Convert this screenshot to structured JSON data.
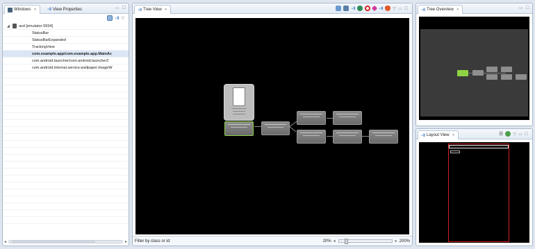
{
  "left": {
    "tabs": [
      {
        "label": "Windows"
      },
      {
        "label": "View Properties"
      }
    ],
    "tree": {
      "device": "avd [emulator-5554]",
      "items": [
        "StatusBar",
        "StatusBarExpanded",
        "TrackingView",
        "com.example.app/com.example.app.MainAc",
        "com.android.launcher/com.android.launcher2",
        "com.android.internal.service.wallpaper.ImageW"
      ],
      "selected_index": 3
    }
  },
  "tree_view": {
    "tab_label": "Tree View",
    "filter_label": "Filter by class or id:",
    "zoom_min_label": "20%",
    "zoom_max_label": "200%"
  },
  "tree_overview": {
    "tab_label": "Tree Overview"
  },
  "layout_view": {
    "tab_label": "Layout View"
  },
  "colors": {
    "selected_node_border": "#8fd245",
    "overview_selected": "#8fd245",
    "layout_outline": "#d21e1e"
  }
}
